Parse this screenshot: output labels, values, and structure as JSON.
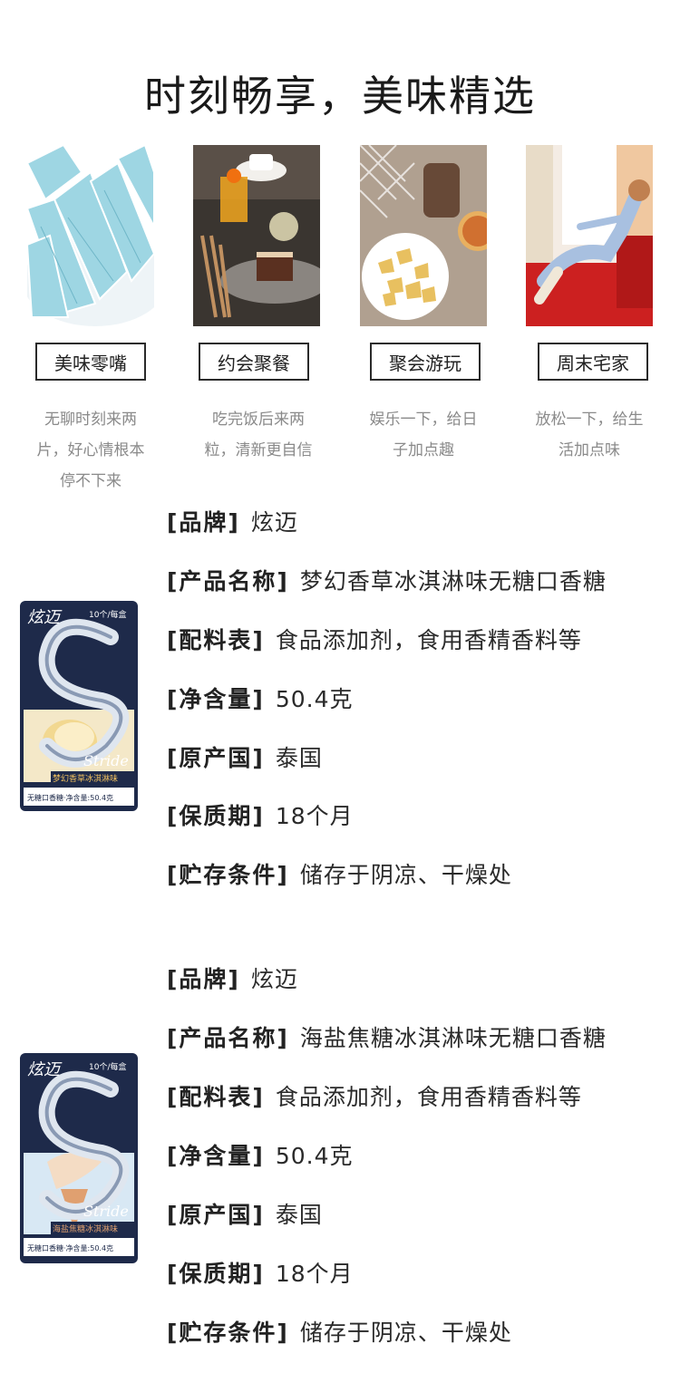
{
  "header": {
    "title": "时刻畅享，美味精选"
  },
  "scenes": [
    {
      "icon": "gum-sticks-photo",
      "tag": "美味零嘴",
      "desc": "无聊时刻来两片，好心情根本停不下来"
    },
    {
      "icon": "dessert-table-photo",
      "tag": "约会聚餐",
      "desc": "吃完饭后来两粒，清新更自信"
    },
    {
      "icon": "snacks-tea-photo",
      "tag": "聚会游玩",
      "desc": "娱乐一下，给日子加点趣"
    },
    {
      "icon": "relaxing-sofa-photo",
      "tag": "周末宅家",
      "desc": "放松一下，给生活加点味"
    }
  ],
  "products": [
    {
      "icon": "stride-vanilla-pack",
      "pack": {
        "brand": "炫迈",
        "badge": "10个/每盒",
        "stride": "Stride",
        "flavor": "梦幻香草冰淇淋味",
        "bottom": "无糖口香糖·净含量:50.4克",
        "accent": "#f0c060"
      },
      "specs": [
        {
          "label": "[品牌]",
          "value": "炫迈"
        },
        {
          "label": "[产品名称]",
          "value": "梦幻香草冰淇淋味无糖口香糖"
        },
        {
          "label": "[配料表]",
          "value": "食品添加剂，食用香精香料等"
        },
        {
          "label": "[净含量]",
          "value": "50.4克"
        },
        {
          "label": "[原产国]",
          "value": "泰国"
        },
        {
          "label": "[保质期]",
          "value": "18个月"
        },
        {
          "label": "[贮存条件]",
          "value": "储存于阴凉、干燥处"
        }
      ]
    },
    {
      "icon": "stride-sea-salt-caramel-pack",
      "pack": {
        "brand": "炫迈",
        "badge": "10个/每盒",
        "stride": "Stride",
        "flavor": "海盐焦糖冰淇淋味",
        "bottom": "无糖口香糖·净含量:50.4克",
        "accent": "#e0a070"
      },
      "specs": [
        {
          "label": "[品牌]",
          "value": "炫迈"
        },
        {
          "label": "[产品名称]",
          "value": "海盐焦糖冰淇淋味无糖口香糖"
        },
        {
          "label": "[配料表]",
          "value": "食品添加剂，食用香精香料等"
        },
        {
          "label": "[净含量]",
          "value": "50.4克"
        },
        {
          "label": "[原产国]",
          "value": "泰国"
        },
        {
          "label": "[保质期]",
          "value": "18个月"
        },
        {
          "label": "[贮存条件]",
          "value": "储存于阴凉、干燥处"
        }
      ]
    }
  ]
}
